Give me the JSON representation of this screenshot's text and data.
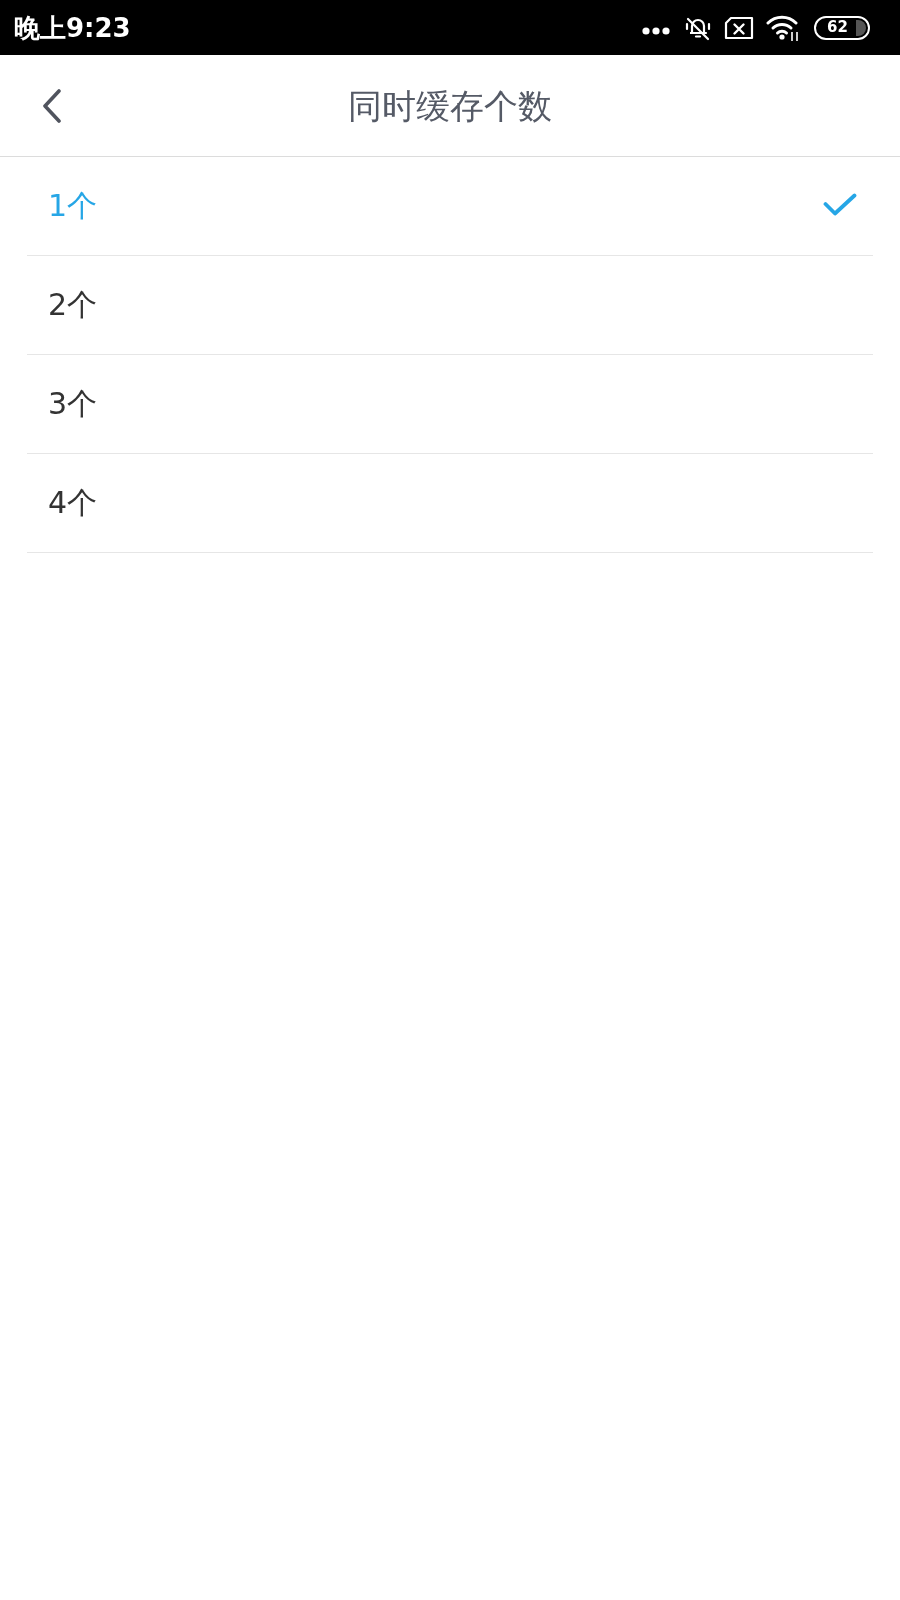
{
  "status_bar": {
    "time": "晚上9:23",
    "battery": "62"
  },
  "header": {
    "title": "同时缓存个数"
  },
  "options": [
    {
      "label": "1个",
      "selected": true
    },
    {
      "label": "2个",
      "selected": false
    },
    {
      "label": "3个",
      "selected": false
    },
    {
      "label": "4个",
      "selected": false
    }
  ]
}
